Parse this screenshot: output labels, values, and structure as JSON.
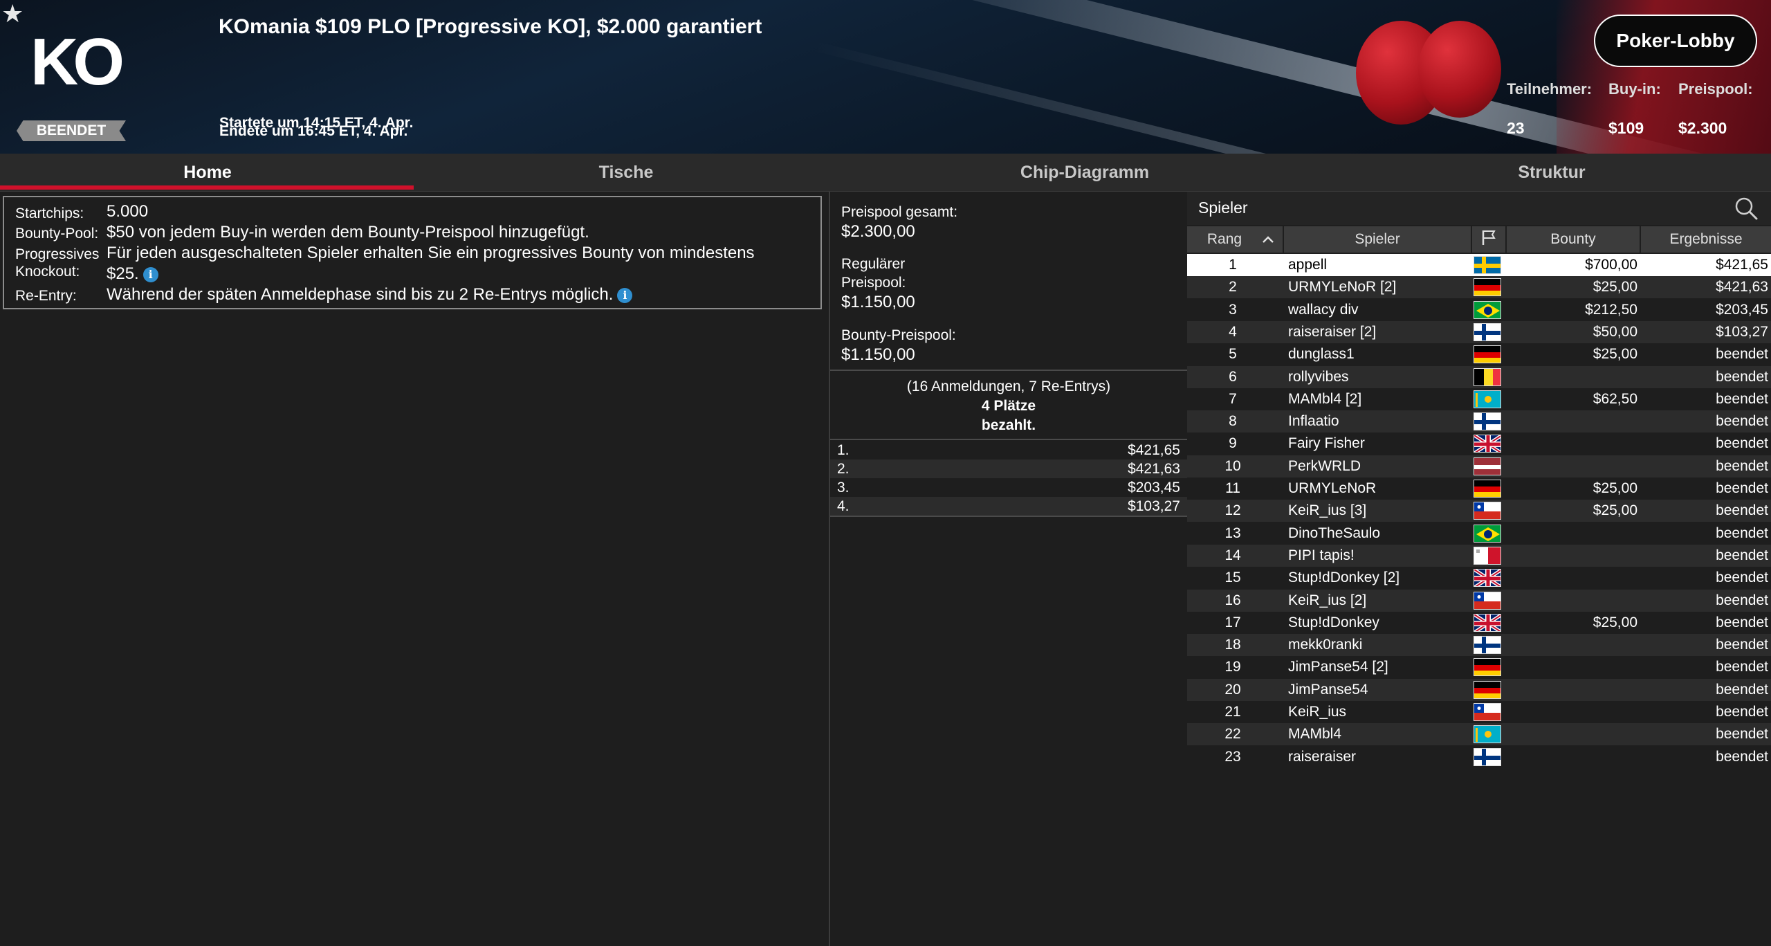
{
  "header": {
    "title": "KOmania $109 PLO [Progressive KO], $2.000 garantiert",
    "status": "BEENDET",
    "started": "Startete um 14:15 ET, 4. Apr.",
    "ended": "Endete um 16:45 ET, 4. Apr.",
    "lobby_button": "Poker-Lobby",
    "logo_text": "KO",
    "stats": {
      "participants_label": "Teilnehmer:",
      "participants_value": "23",
      "buyin_label": "Buy-in:",
      "buyin_value": "$109",
      "prizepool_label": "Preispool:",
      "prizepool_value": "$2.300"
    }
  },
  "tabs": [
    {
      "label": "Home",
      "active": true
    },
    {
      "label": "Tische",
      "active": false
    },
    {
      "label": "Chip-Diagramm",
      "active": false
    },
    {
      "label": "Struktur",
      "active": false
    }
  ],
  "info": {
    "startchips_label": "Startchips:",
    "startchips_value": "5.000",
    "bountypool_label": "Bounty-Pool:",
    "bountypool_value": "$50 von jedem Buy-in werden dem Bounty-Preispool hinzugefügt.",
    "progressive_label_1": "Progressives",
    "progressive_label_2": "Knockout:",
    "progressive_value_1": "Für jeden ausgeschalteten Spieler erhalten Sie ein progressives Bounty von mindestens",
    "progressive_value_2": "$25.",
    "reentry_label": "Re-Entry:",
    "reentry_value": "Während der späten Anmeldephase sind bis zu 2 Re-Entrys möglich."
  },
  "prizepool": {
    "total_label": "Preispool gesamt:",
    "total_value": "$2.300,00",
    "regular_label_1": "Regulärer",
    "regular_label_2": "Preispool:",
    "regular_value": "$1.150,00",
    "bounty_label": "Bounty-Preispool:",
    "bounty_value": "$1.150,00",
    "entries_text": "(16 Anmeldungen, 7 Re-Entrys)",
    "paid_line_1": "4 Plätze",
    "paid_line_2": "bezahlt.",
    "payouts": [
      {
        "place": "1.",
        "amount": "$421,65"
      },
      {
        "place": "2.",
        "amount": "$421,63"
      },
      {
        "place": "3.",
        "amount": "$203,45"
      },
      {
        "place": "4.",
        "amount": "$103,27"
      }
    ]
  },
  "players": {
    "title": "Spieler",
    "columns": {
      "rank": "Rang",
      "player": "Spieler",
      "bounty": "Bounty",
      "result": "Ergebnisse"
    },
    "rows": [
      {
        "rank": "1",
        "name": "appell",
        "flag": "sweden",
        "bounty": "$700,00",
        "result": "$421,65"
      },
      {
        "rank": "2",
        "name": "URMYLeNoR [2]",
        "flag": "germany",
        "bounty": "$25,00",
        "result": "$421,63"
      },
      {
        "rank": "3",
        "name": "wallacy div",
        "flag": "brazil",
        "bounty": "$212,50",
        "result": "$203,45"
      },
      {
        "rank": "4",
        "name": "raiseraiser [2]",
        "flag": "finland",
        "bounty": "$50,00",
        "result": "$103,27"
      },
      {
        "rank": "5",
        "name": "dunglass1",
        "flag": "germany",
        "bounty": "$25,00",
        "result": "beendet"
      },
      {
        "rank": "6",
        "name": "rollyvibes",
        "flag": "belgium",
        "bounty": "",
        "result": "beendet"
      },
      {
        "rank": "7",
        "name": "MAMbl4 [2]",
        "flag": "kazakhstan",
        "bounty": "$62,50",
        "result": "beendet"
      },
      {
        "rank": "8",
        "name": "Inflaatio",
        "flag": "finland",
        "bounty": "",
        "result": "beendet"
      },
      {
        "rank": "9",
        "name": "Fairy Fisher",
        "flag": "uk",
        "bounty": "",
        "result": "beendet"
      },
      {
        "rank": "10",
        "name": "PerkWRLD",
        "flag": "latvia",
        "bounty": "",
        "result": "beendet"
      },
      {
        "rank": "11",
        "name": "URMYLeNoR",
        "flag": "germany",
        "bounty": "$25,00",
        "result": "beendet"
      },
      {
        "rank": "12",
        "name": "KeiR_ius [3]",
        "flag": "chile",
        "bounty": "$25,00",
        "result": "beendet"
      },
      {
        "rank": "13",
        "name": "DinoTheSaulo",
        "flag": "brazil",
        "bounty": "",
        "result": "beendet"
      },
      {
        "rank": "14",
        "name": "PIPI tapis!",
        "flag": "malta",
        "bounty": "",
        "result": "beendet"
      },
      {
        "rank": "15",
        "name": "Stup!dDonkey [2]",
        "flag": "uk",
        "bounty": "",
        "result": "beendet"
      },
      {
        "rank": "16",
        "name": "KeiR_ius [2]",
        "flag": "chile",
        "bounty": "",
        "result": "beendet"
      },
      {
        "rank": "17",
        "name": "Stup!dDonkey",
        "flag": "uk",
        "bounty": "$25,00",
        "result": "beendet"
      },
      {
        "rank": "18",
        "name": "mekk0ranki",
        "flag": "finland",
        "bounty": "",
        "result": "beendet"
      },
      {
        "rank": "19",
        "name": "JimPanse54 [2]",
        "flag": "germany",
        "bounty": "",
        "result": "beendet"
      },
      {
        "rank": "20",
        "name": "JimPanse54",
        "flag": "germany",
        "bounty": "",
        "result": "beendet"
      },
      {
        "rank": "21",
        "name": "KeiR_ius",
        "flag": "chile",
        "bounty": "",
        "result": "beendet"
      },
      {
        "rank": "22",
        "name": "MAMbl4",
        "flag": "kazakhstan",
        "bounty": "",
        "result": "beendet"
      },
      {
        "rank": "23",
        "name": "raiseraiser",
        "flag": "finland",
        "bounty": "",
        "result": "beendet"
      }
    ]
  },
  "colors": {
    "accent": "#d0112b",
    "info_icon": "#2f8fd0",
    "selected_row": "#ffffff"
  }
}
